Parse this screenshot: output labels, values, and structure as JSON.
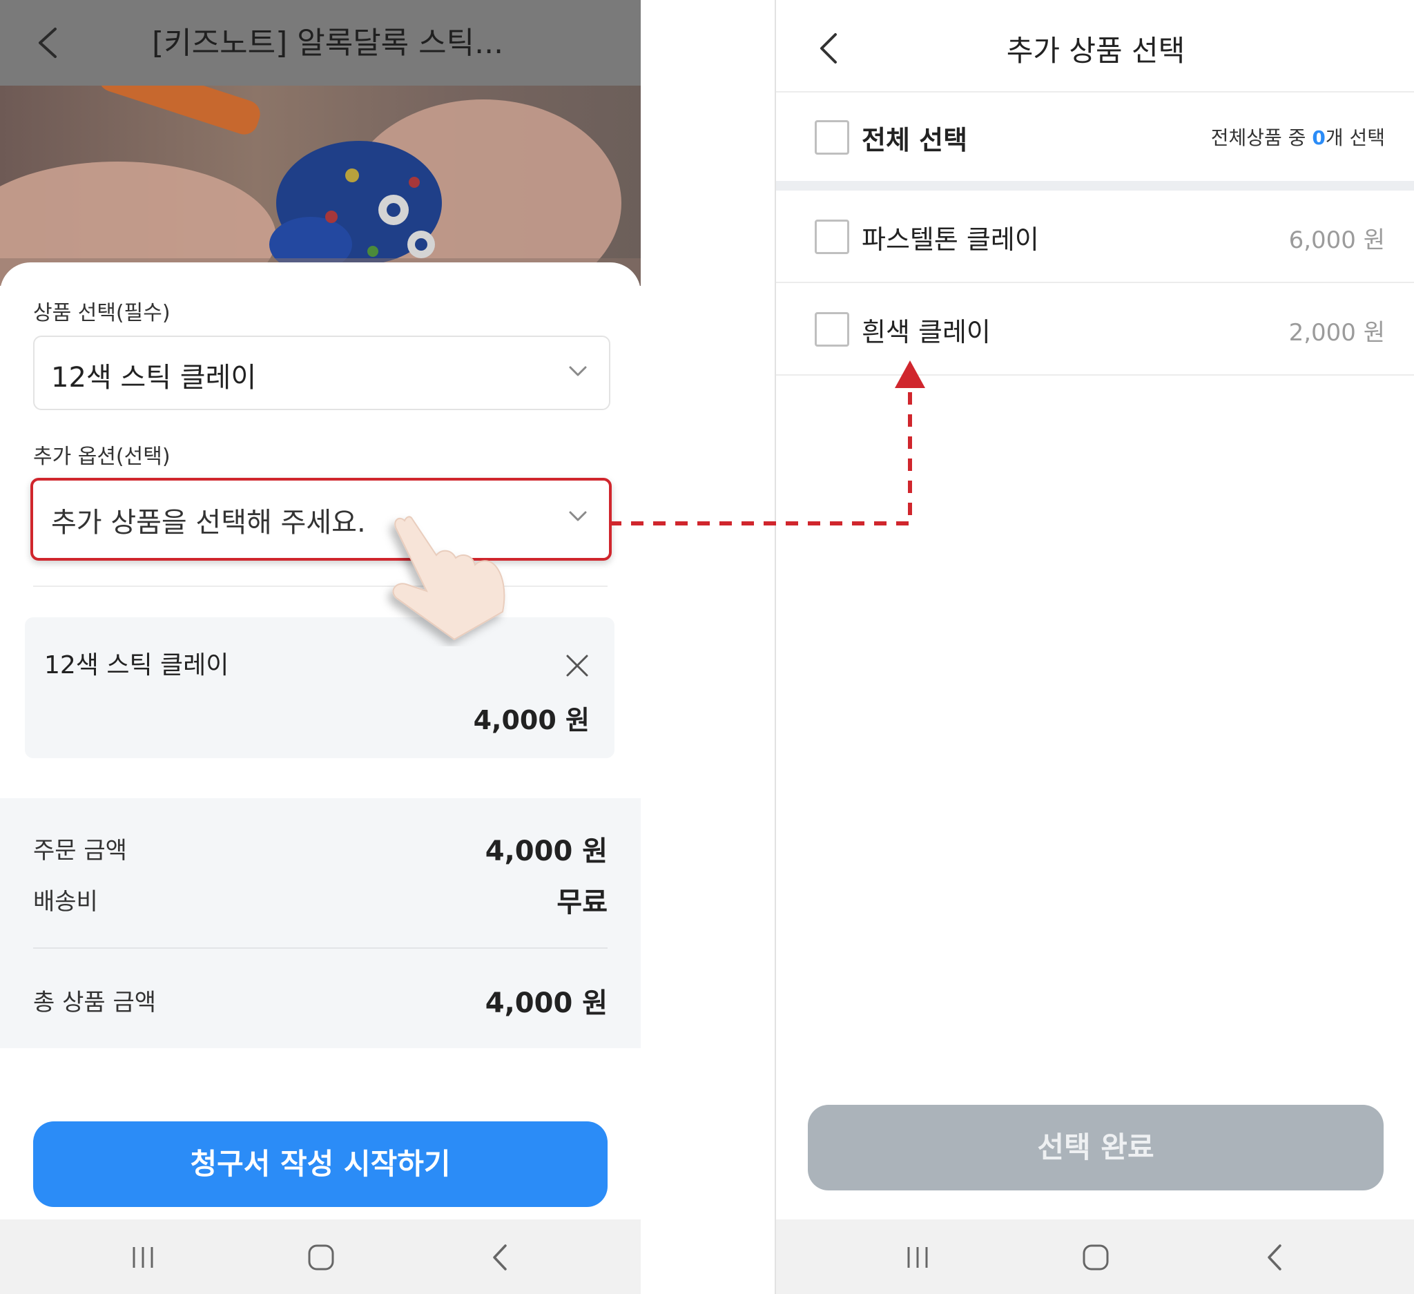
{
  "left": {
    "header": {
      "title": "[키즈노트] 알록달록 스틱..."
    },
    "product_select": {
      "label": "상품 선택(필수)",
      "value": "12색 스틱 클레이"
    },
    "addon_select": {
      "label": "추가 옵션(선택)",
      "placeholder": "추가 상품을 선택해 주세요."
    },
    "selected_item": {
      "name": "12색 스틱 클레이",
      "price": "4,000 원"
    },
    "summary": {
      "order_label": "주문 금액",
      "order_value": "4,000 원",
      "shipping_label": "배송비",
      "shipping_value": "무료",
      "total_label": "총 상품 금액",
      "total_value": "4,000 원"
    },
    "cta_label": "청구서 작성 시작하기"
  },
  "right": {
    "header": {
      "title": "추가 상품 선택"
    },
    "select_all": {
      "label": "전체 선택",
      "count_prefix": "전체상품 중 ",
      "count": "0",
      "count_suffix": "개 선택"
    },
    "items": [
      {
        "name": "파스텔톤 클레이",
        "price": "6,000 원"
      },
      {
        "name": "흰색 클레이",
        "price": "2,000 원"
      }
    ],
    "done_label": "선택 완료"
  },
  "colors": {
    "accent": "#2b8cf7",
    "highlight": "#d0262d",
    "disabled": "#abb3ba"
  },
  "icons": [
    "back-icon",
    "chevron-down-icon",
    "close-icon",
    "checkbox-icon",
    "recent-apps-icon",
    "home-icon",
    "nav-back-icon",
    "pointing-hand-icon"
  ]
}
